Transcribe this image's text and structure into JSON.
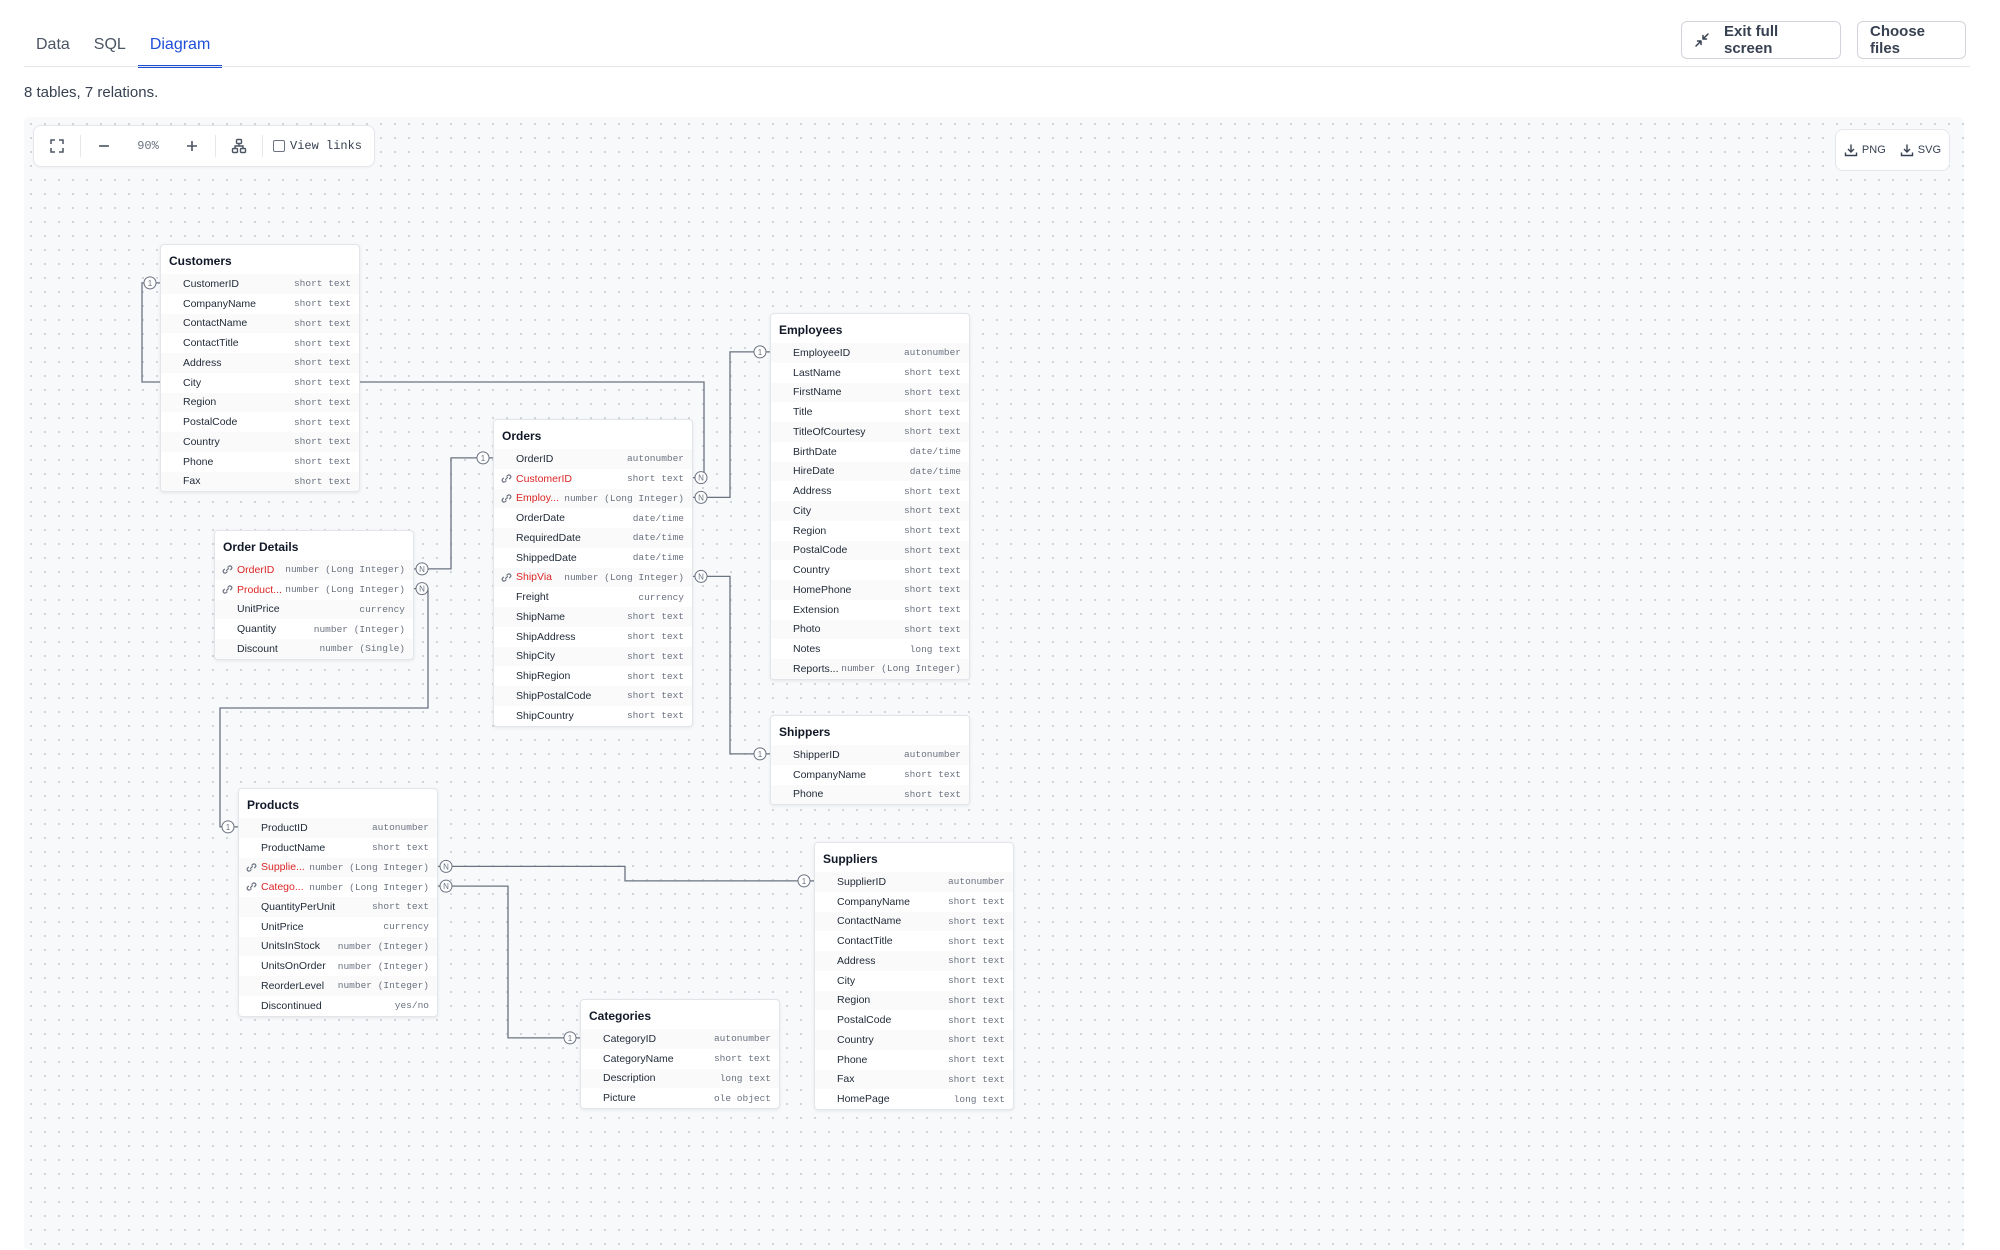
{
  "tabs": [
    {
      "label": "Data"
    },
    {
      "label": "SQL"
    },
    {
      "label": "Diagram",
      "active": true
    }
  ],
  "header": {
    "exit_fullscreen": "Exit full screen",
    "choose_files": "Choose files"
  },
  "summary": "8 tables, 7 relations.",
  "toolbar": {
    "zoom": "90%",
    "view_links": "View links",
    "export_png": "PNG",
    "export_svg": "SVG"
  },
  "colors": {
    "accent": "#1d4ed8",
    "foreign_key": "#dc2626",
    "edge": "#6b7280"
  },
  "tables": [
    {
      "name": "Customers",
      "fields": [
        {
          "name": "CustomerID",
          "type": "short text"
        },
        {
          "name": "CompanyName",
          "type": "short text"
        },
        {
          "name": "ContactName",
          "type": "short text"
        },
        {
          "name": "ContactTitle",
          "type": "short text"
        },
        {
          "name": "Address",
          "type": "short text"
        },
        {
          "name": "City",
          "type": "short text"
        },
        {
          "name": "Region",
          "type": "short text"
        },
        {
          "name": "PostalCode",
          "type": "short text"
        },
        {
          "name": "Country",
          "type": "short text"
        },
        {
          "name": "Phone",
          "type": "short text"
        },
        {
          "name": "Fax",
          "type": "short text"
        }
      ]
    },
    {
      "name": "Order Details",
      "fields": [
        {
          "name": "OrderID",
          "type": "number (Long Integer)",
          "fk": true
        },
        {
          "name": "Product...",
          "type": "number (Long Integer)",
          "fk": true
        },
        {
          "name": "UnitPrice",
          "type": "currency"
        },
        {
          "name": "Quantity",
          "type": "number (Integer)"
        },
        {
          "name": "Discount",
          "type": "number (Single)"
        }
      ]
    },
    {
      "name": "Orders",
      "fields": [
        {
          "name": "OrderID",
          "type": "autonumber"
        },
        {
          "name": "CustomerID",
          "type": "short text",
          "fk": true
        },
        {
          "name": "Employ...",
          "type": "number (Long Integer)",
          "fk": true
        },
        {
          "name": "OrderDate",
          "type": "date/time"
        },
        {
          "name": "RequiredDate",
          "type": "date/time"
        },
        {
          "name": "ShippedDate",
          "type": "date/time"
        },
        {
          "name": "ShipVia",
          "type": "number (Long Integer)",
          "fk": true
        },
        {
          "name": "Freight",
          "type": "currency"
        },
        {
          "name": "ShipName",
          "type": "short text"
        },
        {
          "name": "ShipAddress",
          "type": "short text"
        },
        {
          "name": "ShipCity",
          "type": "short text"
        },
        {
          "name": "ShipRegion",
          "type": "short text"
        },
        {
          "name": "ShipPostalCode",
          "type": "short text"
        },
        {
          "name": "ShipCountry",
          "type": "short text"
        }
      ]
    },
    {
      "name": "Employees",
      "fields": [
        {
          "name": "EmployeeID",
          "type": "autonumber"
        },
        {
          "name": "LastName",
          "type": "short text"
        },
        {
          "name": "FirstName",
          "type": "short text"
        },
        {
          "name": "Title",
          "type": "short text"
        },
        {
          "name": "TitleOfCourtesy",
          "type": "short text"
        },
        {
          "name": "BirthDate",
          "type": "date/time"
        },
        {
          "name": "HireDate",
          "type": "date/time"
        },
        {
          "name": "Address",
          "type": "short text"
        },
        {
          "name": "City",
          "type": "short text"
        },
        {
          "name": "Region",
          "type": "short text"
        },
        {
          "name": "PostalCode",
          "type": "short text"
        },
        {
          "name": "Country",
          "type": "short text"
        },
        {
          "name": "HomePhone",
          "type": "short text"
        },
        {
          "name": "Extension",
          "type": "short text"
        },
        {
          "name": "Photo",
          "type": "short text"
        },
        {
          "name": "Notes",
          "type": "long text"
        },
        {
          "name": "Reports...",
          "type": "number (Long Integer)"
        }
      ]
    },
    {
      "name": "Shippers",
      "fields": [
        {
          "name": "ShipperID",
          "type": "autonumber"
        },
        {
          "name": "CompanyName",
          "type": "short text"
        },
        {
          "name": "Phone",
          "type": "short text"
        }
      ]
    },
    {
      "name": "Products",
      "fields": [
        {
          "name": "ProductID",
          "type": "autonumber"
        },
        {
          "name": "ProductName",
          "type": "short text"
        },
        {
          "name": "Supplie...",
          "type": "number (Long Integer)",
          "fk": true
        },
        {
          "name": "Catego...",
          "type": "number (Long Integer)",
          "fk": true
        },
        {
          "name": "QuantityPerUnit",
          "type": "short text"
        },
        {
          "name": "UnitPrice",
          "type": "currency"
        },
        {
          "name": "UnitsInStock",
          "type": "number (Integer)"
        },
        {
          "name": "UnitsOnOrder",
          "type": "number (Integer)"
        },
        {
          "name": "ReorderLevel",
          "type": "number (Integer)"
        },
        {
          "name": "Discontinued",
          "type": "yes/no"
        }
      ]
    },
    {
      "name": "Suppliers",
      "fields": [
        {
          "name": "SupplierID",
          "type": "autonumber"
        },
        {
          "name": "CompanyName",
          "type": "short text"
        },
        {
          "name": "ContactName",
          "type": "short text"
        },
        {
          "name": "ContactTitle",
          "type": "short text"
        },
        {
          "name": "Address",
          "type": "short text"
        },
        {
          "name": "City",
          "type": "short text"
        },
        {
          "name": "Region",
          "type": "short text"
        },
        {
          "name": "PostalCode",
          "type": "short text"
        },
        {
          "name": "Country",
          "type": "short text"
        },
        {
          "name": "Phone",
          "type": "short text"
        },
        {
          "name": "Fax",
          "type": "short text"
        },
        {
          "name": "HomePage",
          "type": "long text"
        }
      ]
    },
    {
      "name": "Categories",
      "fields": [
        {
          "name": "CategoryID",
          "type": "autonumber"
        },
        {
          "name": "CategoryName",
          "type": "short text"
        },
        {
          "name": "Description",
          "type": "long text"
        },
        {
          "name": "Picture",
          "type": "ole object"
        }
      ]
    }
  ],
  "relations": [
    {
      "from": "Orders.CustomerID",
      "to": "Customers.CustomerID",
      "from_card": "N",
      "to_card": "1"
    },
    {
      "from": "Orders.EmployeeID",
      "to": "Employees.EmployeeID",
      "from_card": "N",
      "to_card": "1"
    },
    {
      "from": "Order Details.OrderID",
      "to": "Orders.OrderID",
      "from_card": "N",
      "to_card": "1"
    },
    {
      "from": "Order Details.ProductID",
      "to": "Products.ProductID",
      "from_card": "N",
      "to_card": "1"
    },
    {
      "from": "Orders.ShipVia",
      "to": "Shippers.ShipperID",
      "from_card": "N",
      "to_card": "1"
    },
    {
      "from": "Products.SupplierID",
      "to": "Suppliers.SupplierID",
      "from_card": "N",
      "to_card": "1"
    },
    {
      "from": "Products.CategoryID",
      "to": "Categories.CategoryID",
      "from_card": "N",
      "to_card": "1"
    }
  ]
}
